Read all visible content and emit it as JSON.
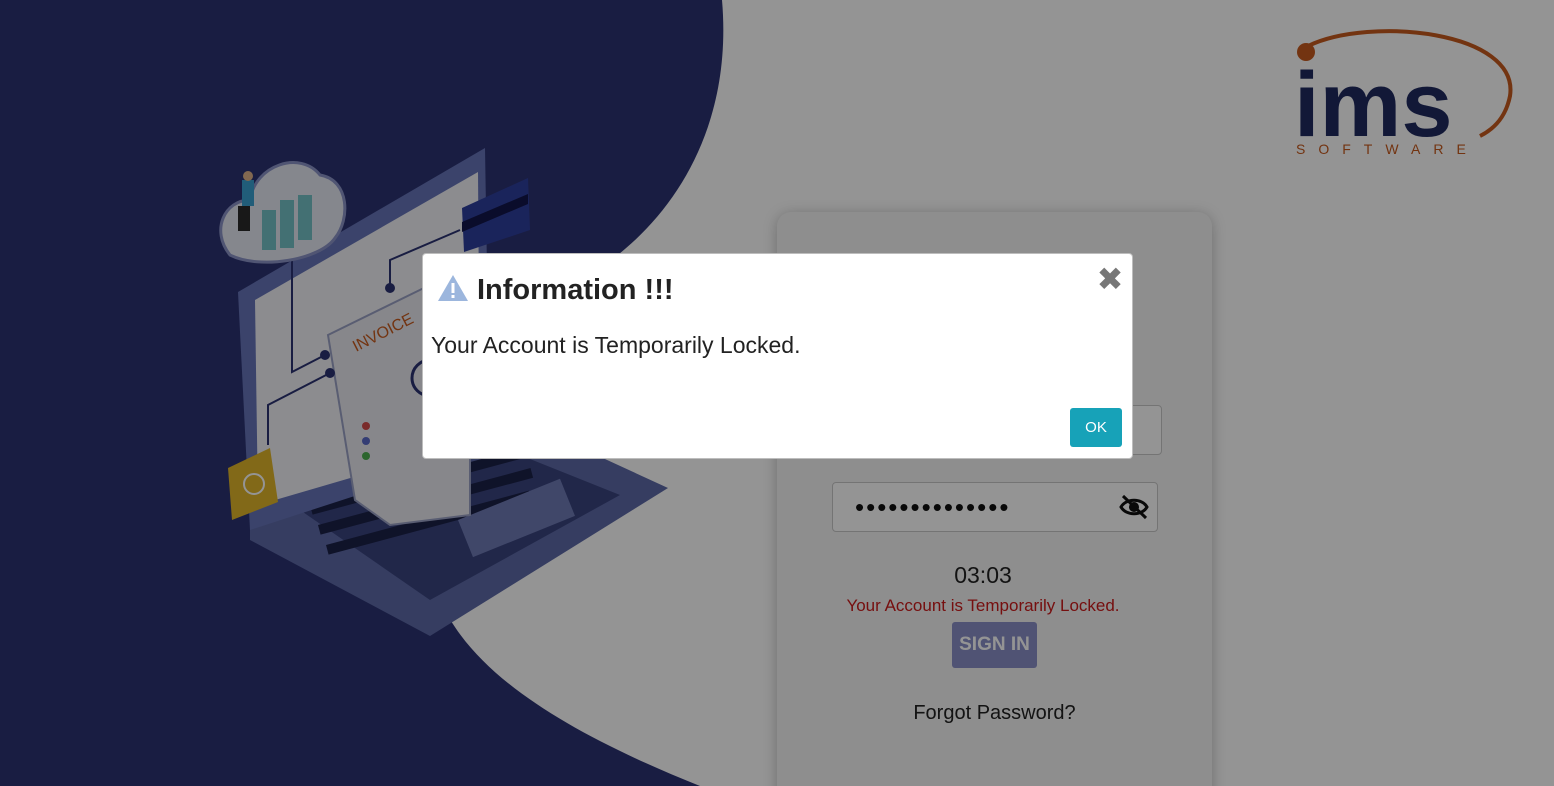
{
  "brand": {
    "logo_text": "ims",
    "logo_subtext": "SOFTWARE",
    "primary_color": "#1f2a5f",
    "accent_color": "#c65a1e"
  },
  "illustration": {
    "document_label": "INVOICE"
  },
  "login": {
    "password_value": "••••••••••••••",
    "eye_icon": "eye-slash-icon",
    "timer": "03:03",
    "lock_message": "Your Account is Temporarily Locked.",
    "signin_label": "SIGN IN",
    "forgot_label": "Forgot Password?"
  },
  "modal": {
    "icon": "warning-icon",
    "title": "Information !!!",
    "message": "Your Account is Temporarily Locked.",
    "close_symbol": "✖",
    "ok_label": "OK"
  }
}
